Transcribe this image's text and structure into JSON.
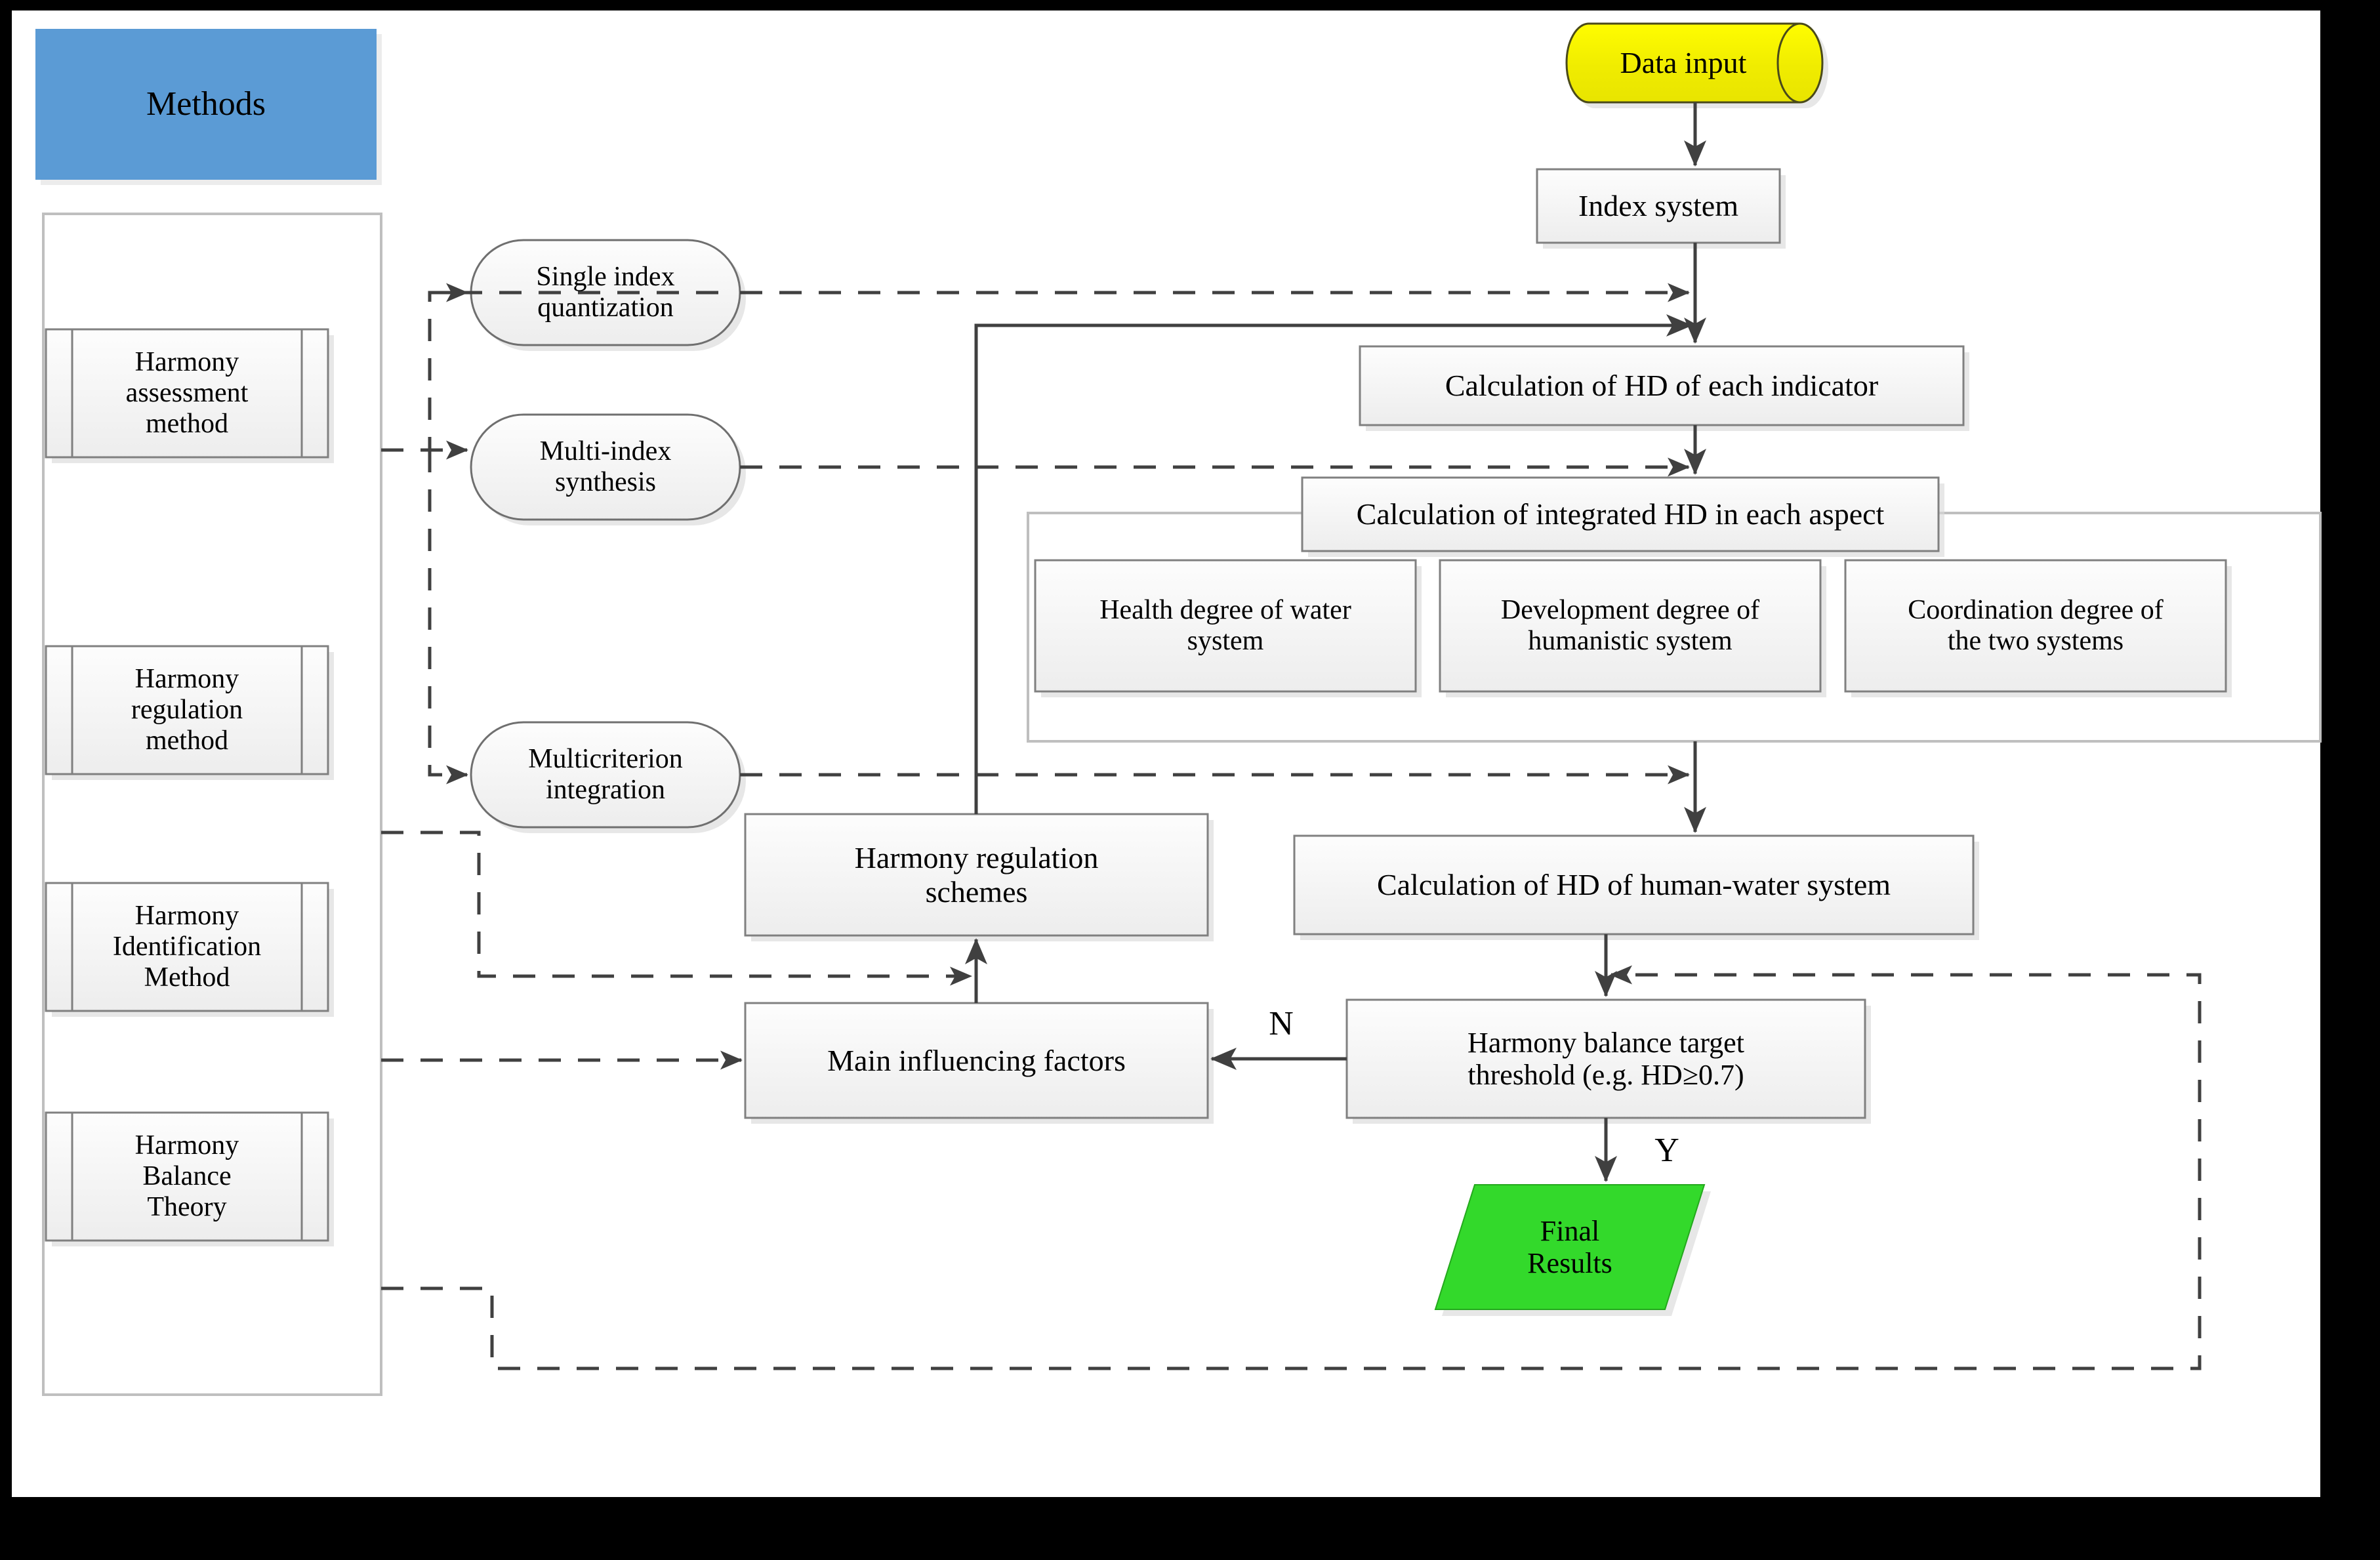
{
  "figure": {
    "title": "Harmony assessment and regulation framework of human-water system",
    "frame_color": "#000000",
    "canvas_color": "#ffffff"
  },
  "palette": {
    "header_blue": "#5b9bd5",
    "node_fill_light": "#f2f2f2",
    "node_fill_light2": "#fafafa",
    "node_border": "#808080",
    "data_input_yellow": "#f2f200",
    "final_results_green": "#33d92b",
    "line_color": "#404040",
    "shadow": "#d9d9d9",
    "text_color": "#000000"
  },
  "methods_panel": {
    "header_label": "Methods",
    "items": [
      {
        "id": "harmony-assessment-method",
        "label": "Harmony\nassessment\nmethod"
      },
      {
        "id": "harmony-regulation-method",
        "label": "Harmony\nregulation\nmethod"
      },
      {
        "id": "harmony-identification-method",
        "label": "Harmony\nIdentification\nMethod"
      },
      {
        "id": "harmony-balance-theory",
        "label": "Harmony\nBalance\nTheory"
      }
    ]
  },
  "technique_nodes": [
    {
      "id": "single-index-quantization",
      "label": "Single index\nquantization"
    },
    {
      "id": "multi-index-synthesis",
      "label": "Multi-index\nsynthesis"
    },
    {
      "id": "multicriterion-integration",
      "label": "Multicriterion\nintegration"
    }
  ],
  "flow_nodes": {
    "data_input": {
      "label": "Data input",
      "shape": "cylinder",
      "fill": "#f2f200"
    },
    "index_system": {
      "label": "Index system",
      "shape": "rect"
    },
    "hd_each_indicator": {
      "label": "Calculation of HD of each indicator",
      "shape": "rect"
    },
    "integrated_hd_aspect": {
      "label": "Calculation of integrated HD in each aspect",
      "shape": "rect"
    },
    "health_degree": {
      "label": "Health degree of water\nsystem",
      "shape": "rect"
    },
    "development_degree": {
      "label": "Development degree of\nhumanistic system",
      "shape": "rect"
    },
    "coordination_degree": {
      "label": "Coordination degree of\nthe two systems",
      "shape": "rect"
    },
    "hd_human_water": {
      "label": "Calculation of HD of human-water system",
      "shape": "rect"
    },
    "harmony_regulation_schemes": {
      "label": "Harmony regulation\nschemes",
      "shape": "rect"
    },
    "main_influencing_factors": {
      "label": "Main influencing factors",
      "shape": "rect"
    },
    "balance_target_threshold": {
      "label": "Harmony balance target\nthreshold (e.g. HD≥0.7)",
      "shape": "rect"
    },
    "final_results": {
      "label": "Final\nResults",
      "shape": "parallelogram",
      "fill": "#33d92b"
    }
  },
  "edge_labels": {
    "no_branch": "N",
    "yes_branch": "Y"
  }
}
